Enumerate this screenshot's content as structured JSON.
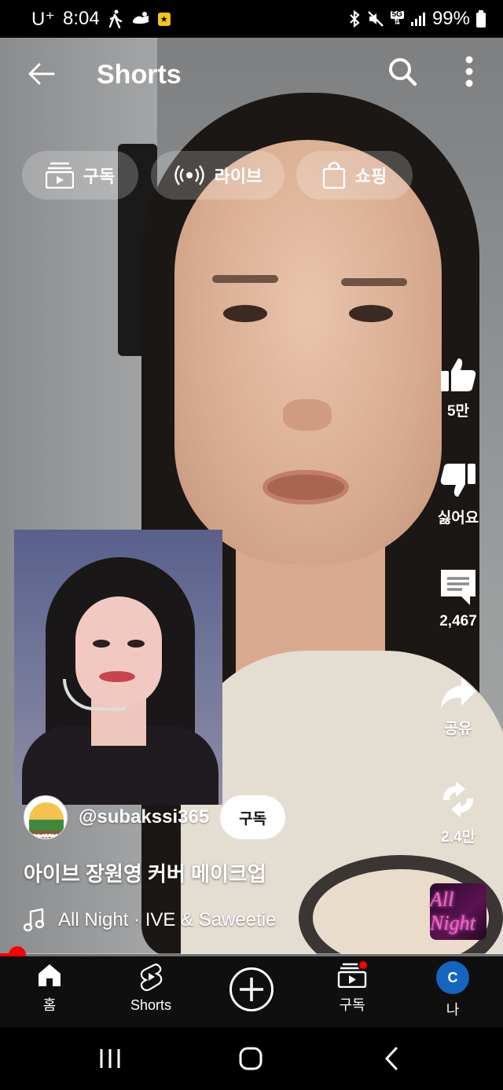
{
  "status_bar": {
    "carrier": "U⁺",
    "time": "8:04",
    "network": "5G",
    "battery": "99%"
  },
  "header": {
    "title": "Shorts"
  },
  "chips": [
    {
      "label": "구독",
      "icon": "subscriptions-icon"
    },
    {
      "label": "라이브",
      "icon": "live-icon"
    },
    {
      "label": "쇼핑",
      "icon": "shopping-bag-icon"
    }
  ],
  "actions": {
    "like_count": "5만",
    "dislike_label": "싫어요",
    "comment_count": "2,467",
    "share_label": "공유",
    "remix_count": "2.4만"
  },
  "channel": {
    "avatar_text": "SUBAKSSI 365",
    "handle": "@subakssi365",
    "subscribe_label": "구독"
  },
  "video": {
    "title": "아이브 장원영 커버 메이크업",
    "music": "All Night · IVE & Saweetie",
    "music_thumb_text": "All Night",
    "progress": 0.035
  },
  "bottom_nav": [
    {
      "label": "홈",
      "icon": "home-icon"
    },
    {
      "label": "Shorts",
      "icon": "shorts-icon"
    },
    {
      "label": "",
      "icon": "create-icon"
    },
    {
      "label": "구독",
      "icon": "subscriptions-icon"
    },
    {
      "label": "나",
      "icon": "avatar"
    }
  ],
  "user_avatar_letter": "C",
  "colors": {
    "accent": "#ff0000",
    "nav_bg": "#0f0f0f",
    "avatar_bg": "#1565c0"
  }
}
